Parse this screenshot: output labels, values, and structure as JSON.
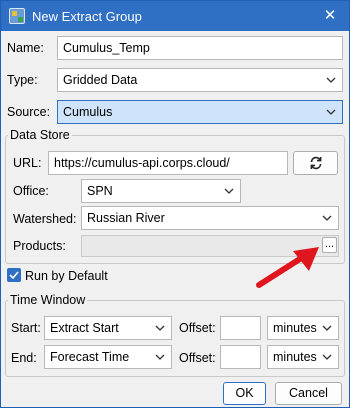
{
  "window": {
    "title": "New Extract Group",
    "close_glyph": "✕"
  },
  "form": {
    "name": {
      "label": "Name:",
      "value": "Cumulus_Temp"
    },
    "type": {
      "label": "Type:",
      "value": "Gridded Data"
    },
    "source": {
      "label": "Source:",
      "value": "Cumulus"
    }
  },
  "data_store": {
    "legend": "Data Store",
    "url": {
      "label": "URL:",
      "value": "https://cumulus-api.corps.cloud/"
    },
    "office": {
      "label": "Office:",
      "value": "SPN"
    },
    "watershed": {
      "label": "Watershed:",
      "value": "Russian River"
    },
    "products": {
      "label": "Products:",
      "value": "",
      "browse_label": "..."
    }
  },
  "run_by_default": {
    "label": "Run by Default",
    "checked": true
  },
  "time_window": {
    "legend": "Time Window",
    "start": {
      "label": "Start:",
      "value": "Extract Start",
      "offset_label": "Offset:",
      "offset_value": "",
      "unit": "minutes"
    },
    "end": {
      "label": "End:",
      "value": "Forecast Time",
      "offset_label": "Offset:",
      "offset_value": "",
      "unit": "minutes"
    }
  },
  "buttons": {
    "ok": "OK",
    "cancel": "Cancel"
  },
  "colors": {
    "accent": "#2f6fc4",
    "annotation_arrow": "#e0161e"
  },
  "icons": {
    "refresh": "refresh-icon",
    "checkmark": "checkmark-icon",
    "chevron": "chevron-down-icon"
  }
}
